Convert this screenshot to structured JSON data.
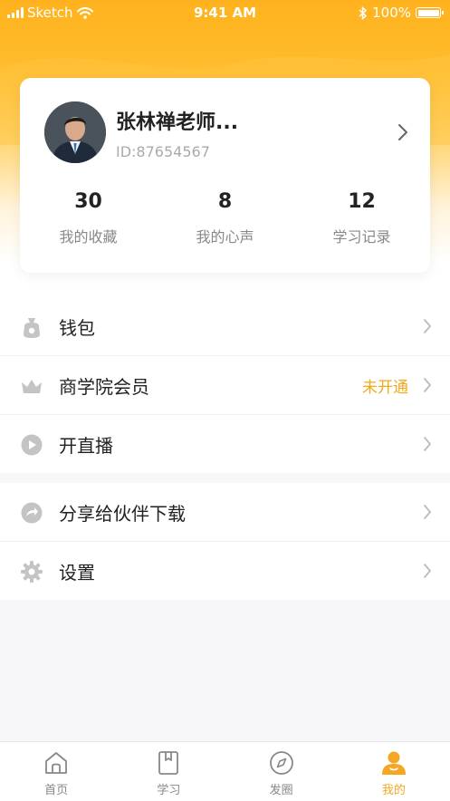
{
  "status_bar": {
    "carrier": "Sketch",
    "time": "9:41 AM",
    "battery": "100%"
  },
  "profile": {
    "name": "张林禅老师...",
    "id": "ID:87654567",
    "stats": [
      {
        "value": "30",
        "label": "我的收藏"
      },
      {
        "value": "8",
        "label": "我的心声"
      },
      {
        "value": "12",
        "label": "学习记录"
      }
    ]
  },
  "menu_group_1": [
    {
      "label": "钱包",
      "icon": "wallet-icon"
    },
    {
      "label": "商学院会员",
      "icon": "crown-icon",
      "extra": "未开通"
    },
    {
      "label": "开直播",
      "icon": "play-icon"
    }
  ],
  "menu_group_2": [
    {
      "label": "分享给伙伴下载",
      "icon": "share-icon"
    },
    {
      "label": "设置",
      "icon": "gear-icon"
    }
  ],
  "tabs": [
    {
      "label": "首页",
      "icon": "home-icon",
      "active": false
    },
    {
      "label": "学习",
      "icon": "book-icon",
      "active": false
    },
    {
      "label": "发圈",
      "icon": "compass-icon",
      "active": false
    },
    {
      "label": "我的",
      "icon": "user-icon",
      "active": true
    }
  ],
  "colors": {
    "accent": "#f5a623",
    "header_gradient_top": "#ffb21e",
    "member_status": "#f1a91a",
    "icon_gray": "#c4c4c4"
  }
}
